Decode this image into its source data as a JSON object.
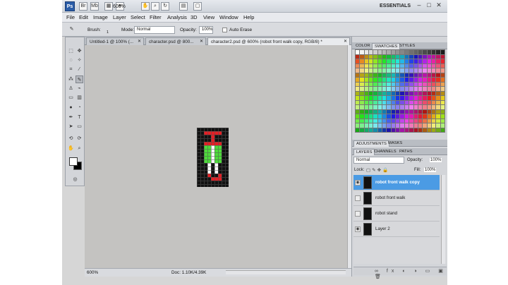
{
  "appbar": {
    "logo": "Ps",
    "zoom": "600%",
    "workspace": "ESSENTIALS",
    "icons": [
      "bridge-icon",
      "mini-bridge-icon",
      "hand-icon",
      "zoom-icon",
      "rotate-view-icon",
      "arrange-icon",
      "screen-mode-icon"
    ]
  },
  "menu": [
    "File",
    "Edit",
    "Image",
    "Layer",
    "Select",
    "Filter",
    "Analysis",
    "3D",
    "View",
    "Window",
    "Help"
  ],
  "options": {
    "brush_label": "Brush:",
    "brush_size": "1",
    "mode_label": "Mode:",
    "mode_value": "Normal",
    "opacity_label": "Opacity:",
    "opacity_value": "100%",
    "auto_erase": "Auto Erase"
  },
  "tabs": [
    {
      "label": "Untitled-1 @ 100% (...",
      "active": false
    },
    {
      "label": "character.psd @ 800...",
      "active": false
    },
    {
      "label": "character2.psd @ 600% (robot front walk copy, RGB/8) *",
      "active": true
    }
  ],
  "statusbar": {
    "zoom": "600%",
    "doc": "Doc: 1.10K/4.39K"
  },
  "panels": {
    "color_tabs": [
      "COLOR",
      "SWATCHES",
      "STYLES"
    ],
    "adj_tabs": [
      "ADJUSTMENTS",
      "MASKS"
    ],
    "layer_tabs": [
      "LAYERS",
      "CHANNELS",
      "PATHS"
    ],
    "blend_mode": "Normal",
    "opacity_label": "Opacity:",
    "opacity_value": "100%",
    "lock_label": "Lock:",
    "fill_label": "Fill:",
    "fill_value": "100%"
  },
  "layers": [
    {
      "name": "robot front walk copy",
      "active": true,
      "visible": true
    },
    {
      "name": "robot front walk",
      "active": false,
      "visible": false
    },
    {
      "name": "robot stand",
      "active": false,
      "visible": false
    },
    {
      "name": "Layer 2",
      "active": false,
      "visible": true
    }
  ],
  "colors": {
    "accent_selected": "#4b9be4",
    "robot_red": "#e41e24",
    "robot_green": "#4ddc3a",
    "robot_white": "#ffffff"
  }
}
